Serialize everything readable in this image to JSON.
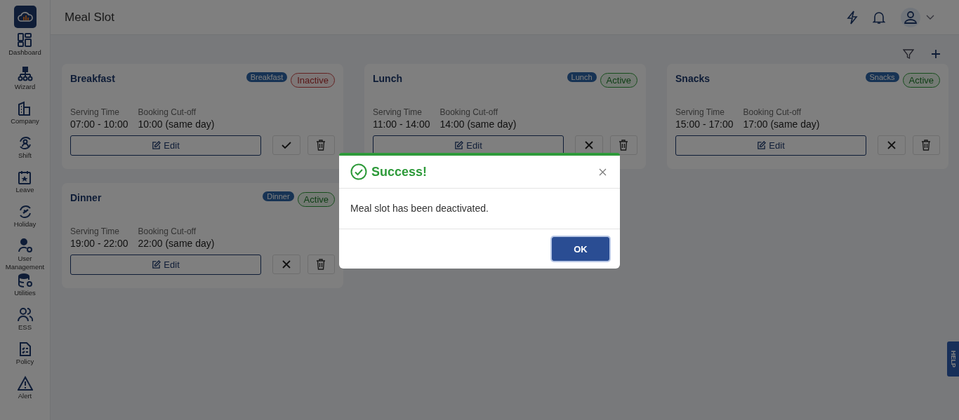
{
  "sidebar": {
    "items": [
      {
        "label": "Dashboard"
      },
      {
        "label": "Wizard"
      },
      {
        "label": "Company"
      },
      {
        "label": "Shift"
      },
      {
        "label": "Leave"
      },
      {
        "label": "Holiday"
      },
      {
        "label": "User Management"
      },
      {
        "label": "Utilities"
      },
      {
        "label": "ESS"
      },
      {
        "label": "Policy"
      },
      {
        "label": "Alert"
      }
    ]
  },
  "header": {
    "title": "Meal Slot"
  },
  "meal_slots": [
    {
      "title": "Breakfast",
      "tag": "Breakfast",
      "status": "Inactive",
      "active": false,
      "serving_label": "Serving Time",
      "serving_time": "07:00 - 10:00",
      "cutoff_label": "Booking Cut-off",
      "cutoff": "10:00 (same day)",
      "edit": "Edit"
    },
    {
      "title": "Lunch",
      "tag": "Lunch",
      "status": "Active",
      "active": true,
      "serving_label": "Serving Time",
      "serving_time": "11:00 - 14:00",
      "cutoff_label": "Booking Cut-off",
      "cutoff": "14:00 (same day)",
      "edit": "Edit"
    },
    {
      "title": "Snacks",
      "tag": "Snacks",
      "status": "Active",
      "active": true,
      "serving_label": "Serving Time",
      "serving_time": "15:00 - 17:00",
      "cutoff_label": "Booking Cut-off",
      "cutoff": "17:00 (same day)",
      "edit": "Edit"
    },
    {
      "title": "Dinner",
      "tag": "Dinner",
      "status": "Active",
      "active": true,
      "serving_label": "Serving Time",
      "serving_time": "19:00 - 22:00",
      "cutoff_label": "Booking Cut-off",
      "cutoff": "22:00 (same day)",
      "edit": "Edit"
    }
  ],
  "dialog": {
    "title": "Success!",
    "message": "Meal slot has been deactivated.",
    "button": "OK"
  },
  "help_tab": "HELP"
}
